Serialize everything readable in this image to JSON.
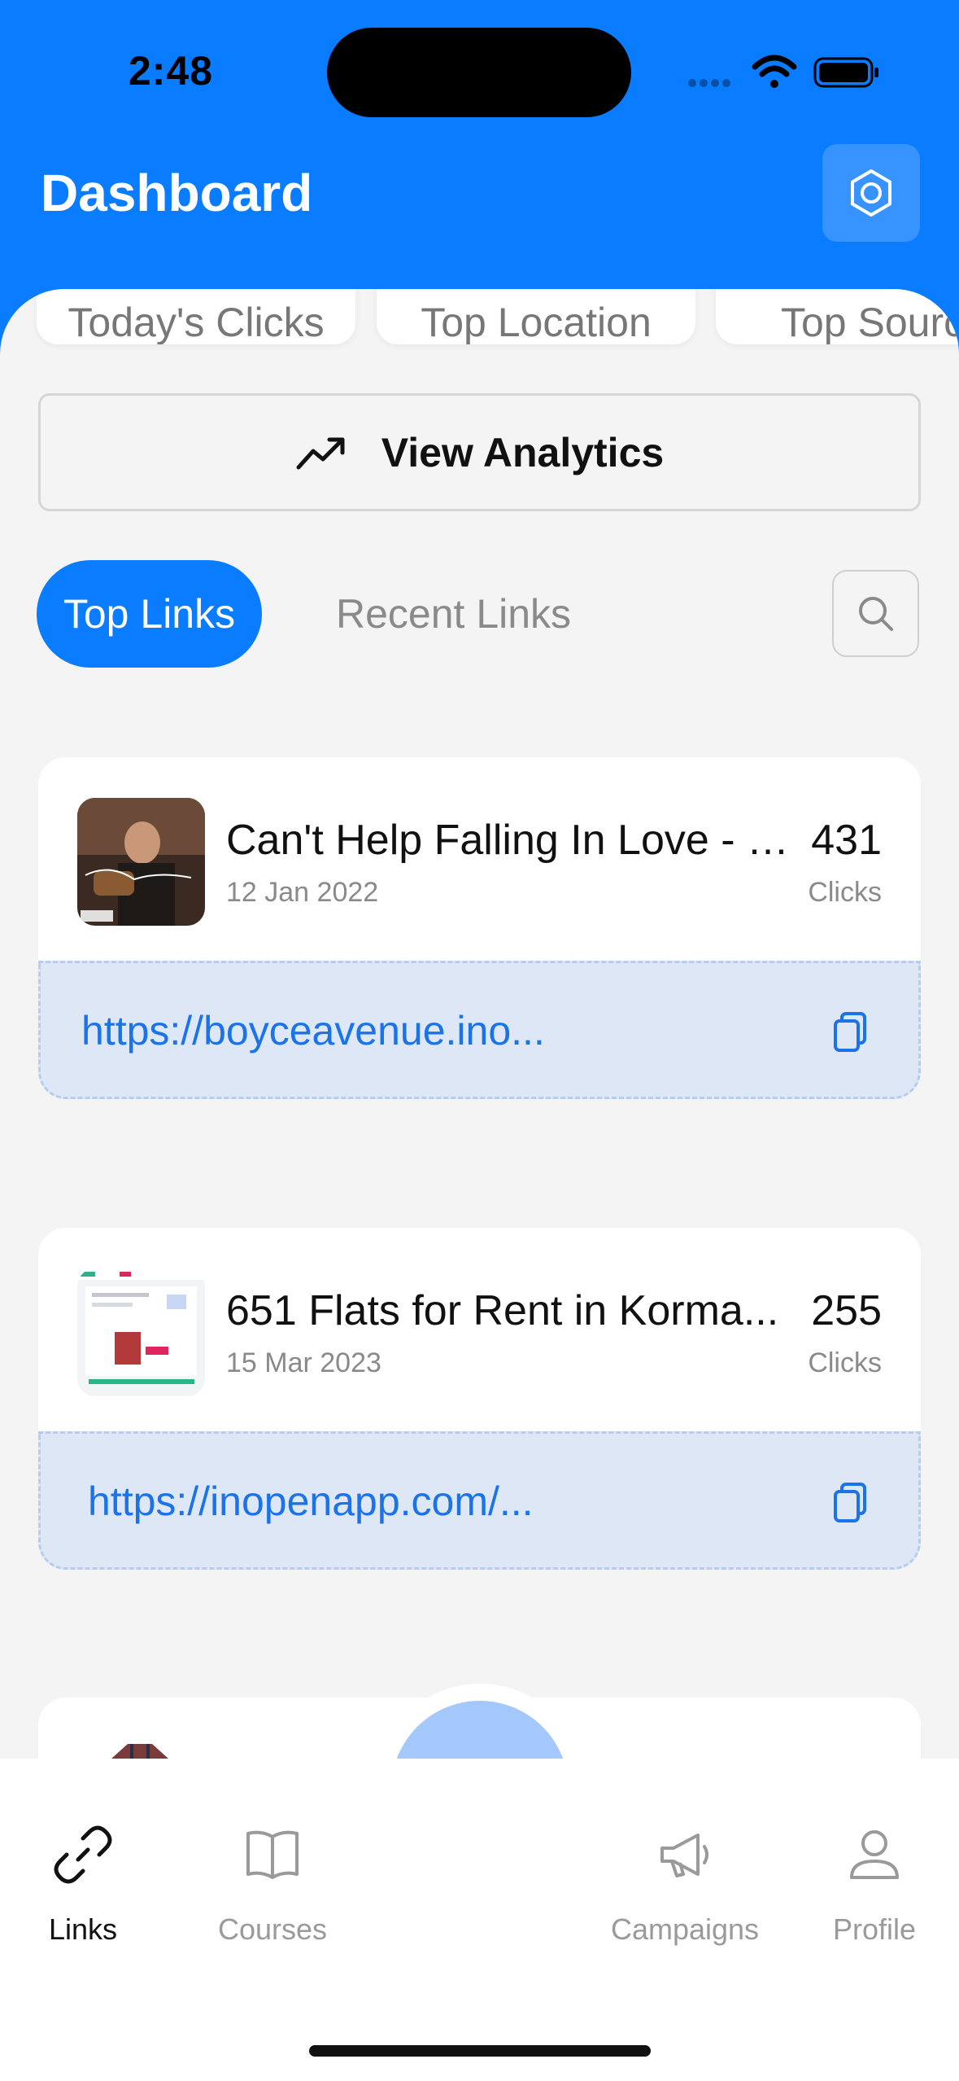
{
  "status_bar": {
    "time": "2:48"
  },
  "header": {
    "title": "Dashboard",
    "settings_icon": "hexagon-settings-icon"
  },
  "stats": [
    {
      "label": "Today's Clicks"
    },
    {
      "label": "Top Location"
    },
    {
      "label": "Top Source"
    }
  ],
  "analytics_button": {
    "label": "View Analytics",
    "icon": "trending-up-icon"
  },
  "tabs": [
    {
      "label": "Top Links",
      "active": true
    },
    {
      "label": "Recent Links",
      "active": false
    }
  ],
  "links": [
    {
      "title": "Can't Help Falling In Love - E...",
      "date": "12 Jan 2022",
      "count": "431",
      "unit": "Clicks",
      "url": "https://boyceavenue.ino..."
    },
    {
      "title": "651   Flats for Rent in Korma...",
      "date": "15 Mar 2023",
      "count": "255",
      "unit": "Clicks",
      "url": "https://inopenapp.com/..."
    }
  ],
  "tabbar": {
    "items": [
      {
        "label": "Links",
        "icon": "link-icon",
        "active": true
      },
      {
        "label": "Courses",
        "icon": "book-icon",
        "active": false
      },
      {
        "label": "Campaigns",
        "icon": "megaphone-icon",
        "active": false
      },
      {
        "label": "Profile",
        "icon": "user-icon",
        "active": false
      }
    ],
    "fab_icon": "plus-icon"
  },
  "colors": {
    "primary": "#0a7cff",
    "link": "#1a73e8",
    "fab": "#a4c8fb",
    "background": "#f4f4f4"
  }
}
